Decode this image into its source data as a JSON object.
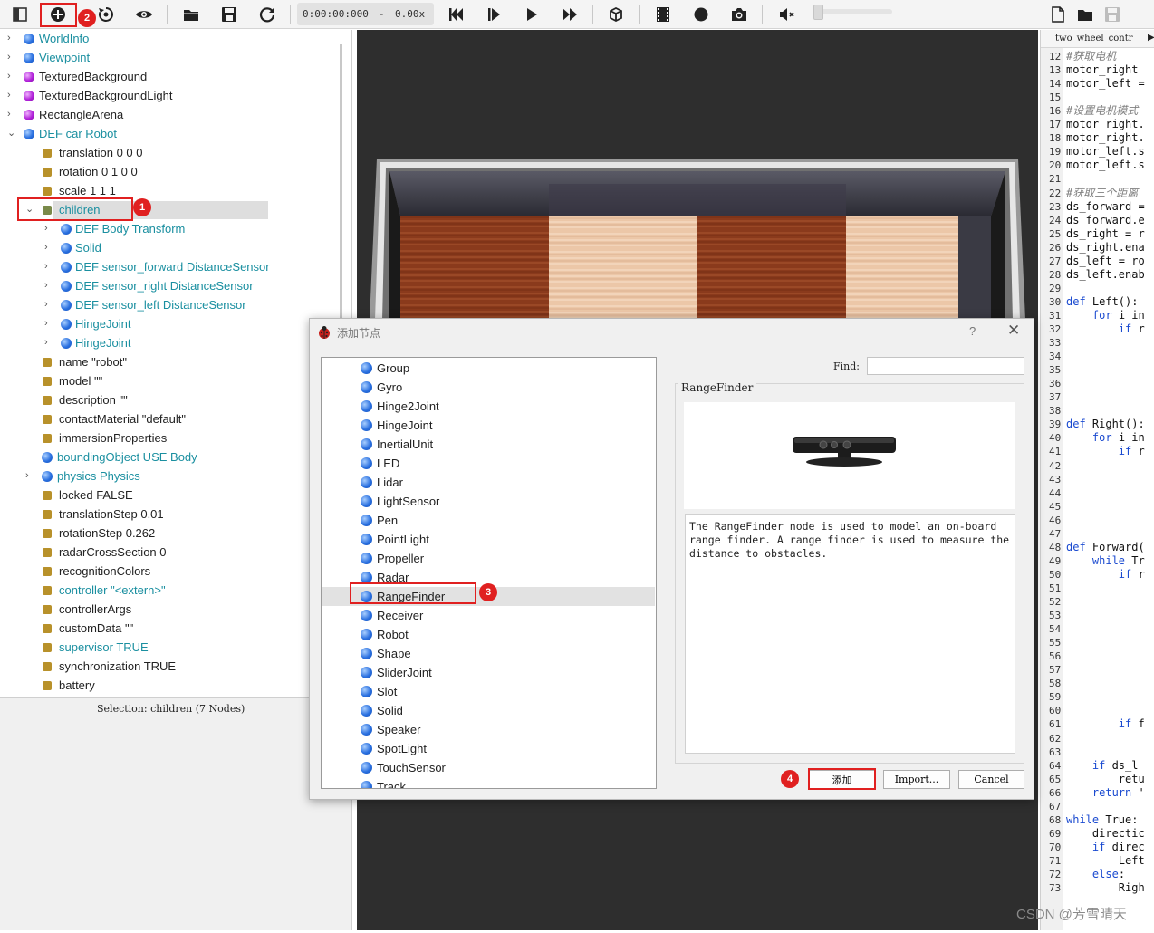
{
  "toolbar": {
    "time": "0:00:00:000",
    "time_sep": "-",
    "speed": "0.00x"
  },
  "scene_tree": {
    "items": [
      {
        "label": "WorldInfo"
      },
      {
        "label": "Viewpoint"
      },
      {
        "label": "TexturedBackground"
      },
      {
        "label": "TexturedBackgroundLight"
      },
      {
        "label": "RectangleArena"
      },
      {
        "label": "DEF car Robot"
      },
      {
        "label": "translation 0 0 0"
      },
      {
        "label": "rotation 0 1 0 0"
      },
      {
        "label": "scale 1 1 1"
      },
      {
        "label": "children"
      },
      {
        "label": "DEF Body Transform"
      },
      {
        "label": "Solid"
      },
      {
        "label": "DEF sensor_forward DistanceSensor"
      },
      {
        "label": "DEF sensor_right DistanceSensor"
      },
      {
        "label": "DEF sensor_left DistanceSensor"
      },
      {
        "label": "HingeJoint"
      },
      {
        "label": "HingeJoint"
      },
      {
        "label": "name \"robot\""
      },
      {
        "label": "model \"\""
      },
      {
        "label": "description \"\""
      },
      {
        "label": "contactMaterial \"default\""
      },
      {
        "label": "immersionProperties"
      },
      {
        "label": "boundingObject USE Body"
      },
      {
        "label": "physics Physics"
      },
      {
        "label": "locked FALSE"
      },
      {
        "label": "translationStep 0.01"
      },
      {
        "label": "rotationStep 0.262"
      },
      {
        "label": "radarCrossSection 0"
      },
      {
        "label": "recognitionColors"
      },
      {
        "label": "controller \"<extern>\""
      },
      {
        "label": "controllerArgs"
      },
      {
        "label": "customData \"\""
      },
      {
        "label": "supervisor TRUE"
      },
      {
        "label": "synchronization TRUE"
      },
      {
        "label": "battery"
      }
    ]
  },
  "field_panel": {
    "selection": "Selection: children (7 Nodes)"
  },
  "editor": {
    "tab_label": "two_wheel_contr",
    "lines": [
      {
        "n": "12",
        "t": "#获取电机"
      },
      {
        "n": "13",
        "t": "motor_right"
      },
      {
        "n": "14",
        "t": "motor_left ="
      },
      {
        "n": "15",
        "t": ""
      },
      {
        "n": "16",
        "t": "#设置电机模式"
      },
      {
        "n": "17",
        "t": "motor_right."
      },
      {
        "n": "18",
        "t": "motor_right."
      },
      {
        "n": "19",
        "t": "motor_left.s"
      },
      {
        "n": "20",
        "t": "motor_left.s"
      },
      {
        "n": "21",
        "t": ""
      },
      {
        "n": "22",
        "t": "#获取三个距离"
      },
      {
        "n": "23",
        "t": "ds_forward ="
      },
      {
        "n": "24",
        "t": "ds_forward.e"
      },
      {
        "n": "25",
        "t": "ds_right = r"
      },
      {
        "n": "26",
        "t": "ds_right.ena"
      },
      {
        "n": "27",
        "t": "ds_left = ro"
      },
      {
        "n": "28",
        "t": "ds_left.enab"
      },
      {
        "n": "29",
        "t": ""
      },
      {
        "n": "30",
        "t": "def Left():"
      },
      {
        "n": "31",
        "t": "    for i in"
      },
      {
        "n": "32",
        "t": "        if r"
      },
      {
        "n": "33",
        "t": ""
      },
      {
        "n": "34",
        "t": ""
      },
      {
        "n": "35",
        "t": ""
      },
      {
        "n": "36",
        "t": ""
      },
      {
        "n": "37",
        "t": ""
      },
      {
        "n": "38",
        "t": ""
      },
      {
        "n": "39",
        "t": "def Right():"
      },
      {
        "n": "40",
        "t": "    for i in"
      },
      {
        "n": "41",
        "t": "        if r"
      },
      {
        "n": "42",
        "t": ""
      },
      {
        "n": "43",
        "t": ""
      },
      {
        "n": "44",
        "t": ""
      },
      {
        "n": "45",
        "t": ""
      },
      {
        "n": "46",
        "t": ""
      },
      {
        "n": "47",
        "t": ""
      },
      {
        "n": "48",
        "t": "def Forward("
      },
      {
        "n": "49",
        "t": "    while Tr"
      },
      {
        "n": "50",
        "t": "        if r"
      },
      {
        "n": "51",
        "t": ""
      },
      {
        "n": "52",
        "t": ""
      },
      {
        "n": "53",
        "t": ""
      },
      {
        "n": "54",
        "t": ""
      },
      {
        "n": "55",
        "t": ""
      },
      {
        "n": "56",
        "t": ""
      },
      {
        "n": "57",
        "t": ""
      },
      {
        "n": "58",
        "t": ""
      },
      {
        "n": "59",
        "t": ""
      },
      {
        "n": "60",
        "t": ""
      },
      {
        "n": "61",
        "t": "        if f"
      },
      {
        "n": "62",
        "t": ""
      },
      {
        "n": "63",
        "t": ""
      },
      {
        "n": "64",
        "t": "    if ds_l"
      },
      {
        "n": "65",
        "t": "        retu"
      },
      {
        "n": "66",
        "t": "    return '"
      },
      {
        "n": "67",
        "t": ""
      },
      {
        "n": "68",
        "t": "while True:"
      },
      {
        "n": "69",
        "t": "    directic"
      },
      {
        "n": "70",
        "t": "    if direc"
      },
      {
        "n": "71",
        "t": "        Left"
      },
      {
        "n": "72",
        "t": "    else:"
      },
      {
        "n": "73",
        "t": "        Righ"
      }
    ]
  },
  "watermark": "CSDN @芳雪晴天",
  "dialog": {
    "title": "添加节点",
    "help": "?",
    "close": "✕",
    "nodes": [
      "Group",
      "Gyro",
      "Hinge2Joint",
      "HingeJoint",
      "InertialUnit",
      "LED",
      "Lidar",
      "LightSensor",
      "Pen",
      "PointLight",
      "Propeller",
      "Radar",
      "RangeFinder",
      "Receiver",
      "Robot",
      "Shape",
      "SliderJoint",
      "Slot",
      "Solid",
      "Speaker",
      "SpotLight",
      "TouchSensor",
      "Track"
    ],
    "selected_node": "RangeFinder",
    "find_label": "Find:",
    "find_value": "",
    "info_title": "RangeFinder",
    "info_text": "The RangeFinder node is used to model an on-board range finder. A range finder is used to measure the distance to obstacles.",
    "add_label": "添加",
    "import_label": "Import...",
    "cancel_label": "Cancel"
  },
  "annotations": [
    "1",
    "2",
    "3",
    "4"
  ],
  "colors": {
    "highlight": "#e02020",
    "node_blue": "#2a70e0",
    "node_purple": "#b020d8",
    "field_gold": "#b8912a",
    "teal_text": "#1a8fa0"
  }
}
